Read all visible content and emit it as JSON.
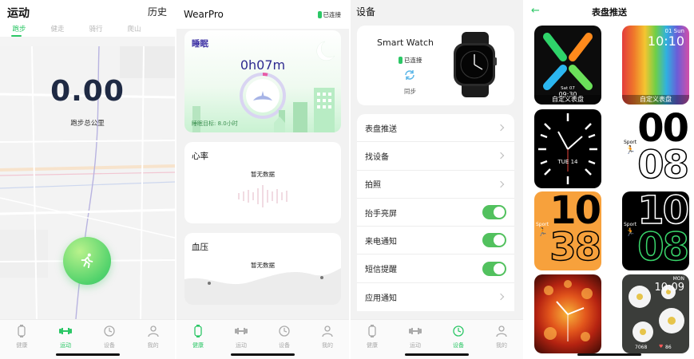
{
  "screen_motion": {
    "title": "运动",
    "history": "历史",
    "tabs": [
      "跑步",
      "健走",
      "骑行",
      "爬山"
    ],
    "distance": "0.00",
    "distance_label": "跑步总公里"
  },
  "screen_health": {
    "app_name": "WearPro",
    "connection": "已连接",
    "sleep_title": "睡眠",
    "sleep_value": "0h07m",
    "sleep_goal": "睡眠目标: 8.0小时",
    "heart_title": "心率",
    "heart_empty": "暂无数据",
    "bp_title": "血压",
    "bp_empty": "暂无数据"
  },
  "screen_device": {
    "title": "设备",
    "device_name": "Smart Watch",
    "connection": "已连接",
    "sync_label": "同步",
    "menu": [
      {
        "label": "表盘推送",
        "type": "chevron"
      },
      {
        "label": "找设备",
        "type": "chevron"
      },
      {
        "label": "拍照",
        "type": "chevron"
      },
      {
        "label": "抬手亮屏",
        "type": "toggle",
        "on": true
      },
      {
        "label": "来电通知",
        "type": "toggle",
        "on": true
      },
      {
        "label": "短信提醒",
        "type": "toggle",
        "on": true
      },
      {
        "label": "应用通知",
        "type": "chevron"
      }
    ]
  },
  "screen_faces": {
    "title": "表盘推送",
    "faces": [
      {
        "caption": "自定义表盘",
        "date": "Sat 07",
        "time": "09:30"
      },
      {
        "caption": "自定义表盘",
        "date": "01 Sun",
        "time": "10:10"
      },
      {
        "caption": "",
        "date": "TUE 14"
      },
      {
        "caption": "",
        "label": "Sport",
        "hour": "00",
        "minute": "08"
      },
      {
        "caption": "",
        "label": "Sport",
        "hour": "10",
        "minute": "38"
      },
      {
        "caption": "",
        "label": "Sport",
        "hour": "10",
        "minute": "08"
      },
      {
        "caption": ""
      },
      {
        "caption": "",
        "day": "MON",
        "time": "10:09",
        "steps": "7068",
        "heart": "86"
      }
    ]
  },
  "tabbar": {
    "health": "健康",
    "motion": "运动",
    "device": "设备",
    "mine": "我的"
  },
  "colors": {
    "accent": "#2cc766",
    "toggle_on": "#52c15e",
    "sleep_title": "#3b2ea3"
  }
}
